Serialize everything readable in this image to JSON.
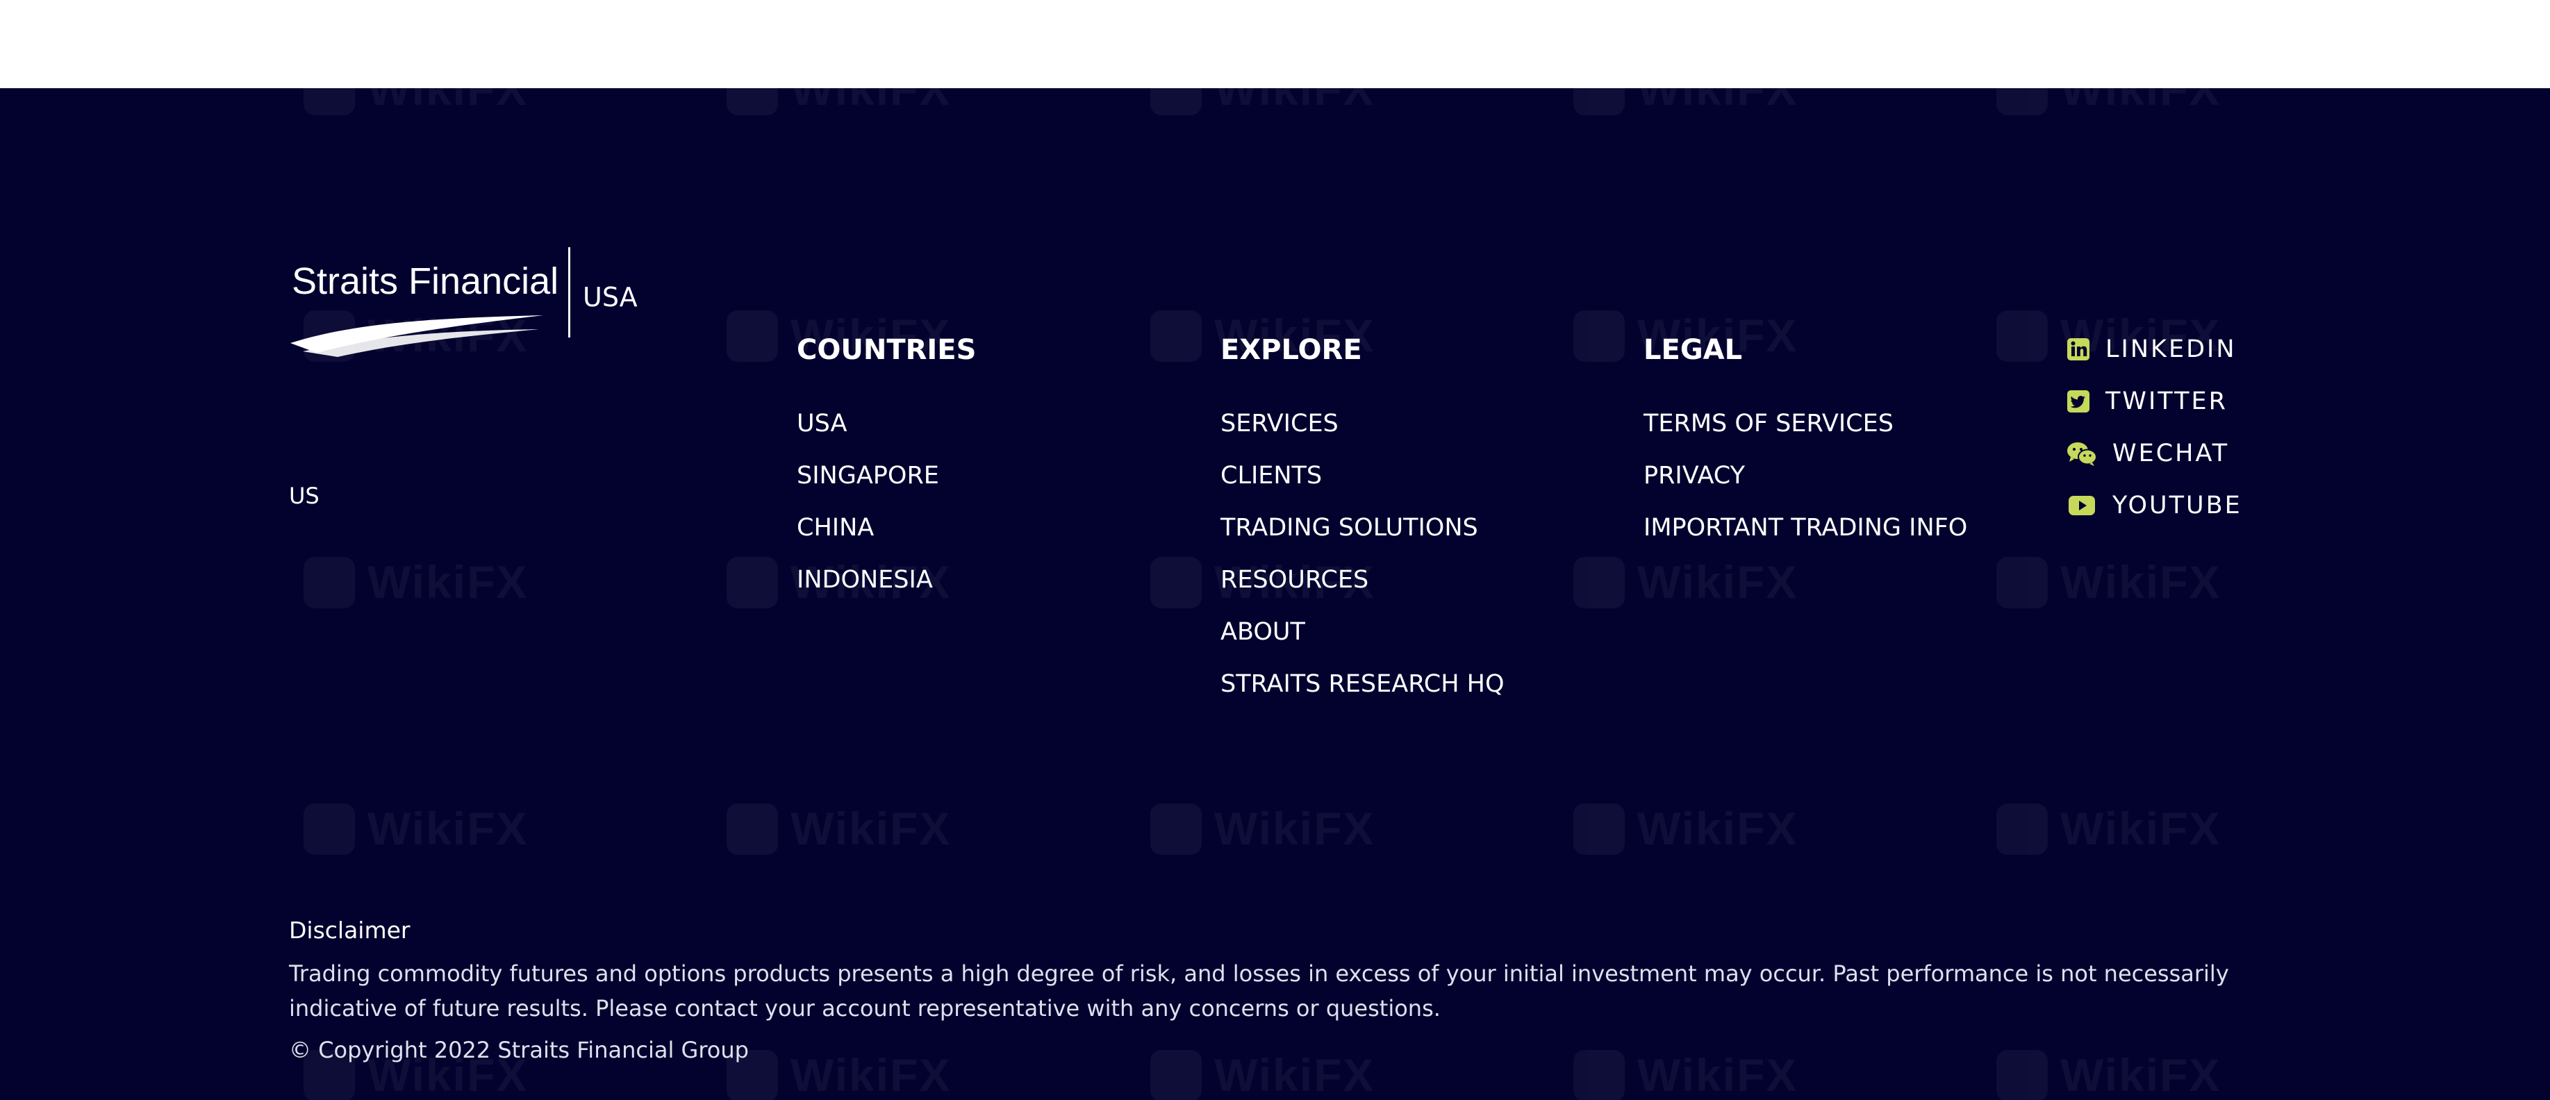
{
  "brand": {
    "name": "Straits Financial",
    "region": "USA",
    "subtitle": "US"
  },
  "columns": [
    {
      "title": "COUNTRIES",
      "items": [
        "USA",
        "SINGAPORE",
        "CHINA",
        "INDONESIA"
      ]
    },
    {
      "title": "EXPLORE",
      "items": [
        "SERVICES",
        "CLIENTS",
        "TRADING SOLUTIONS",
        "RESOURCES",
        "ABOUT",
        "STRAITS RESEARCH HQ"
      ]
    },
    {
      "title": "LEGAL",
      "items": [
        "TERMS OF SERVICES",
        "PRIVACY",
        "IMPORTANT TRADING INFO"
      ]
    }
  ],
  "social": [
    {
      "label": "LINKEDIN",
      "icon": "linkedin-icon"
    },
    {
      "label": "TWITTER",
      "icon": "twitter-icon"
    },
    {
      "label": "WECHAT",
      "icon": "wechat-icon"
    },
    {
      "label": "YOUTUBE",
      "icon": "youtube-icon"
    }
  ],
  "disclaimer": {
    "title": "Disclaimer",
    "text": "Trading commodity futures and options products presents a high degree of risk, and losses in excess of your initial investment may occur.  Past performance is not necessarily indicative of future results. Please contact your account representative with any concerns or questions.",
    "copyright": "© Copyright 2022 Straits Financial Group"
  },
  "watermark": "WikiFX",
  "colors": {
    "footer_bg": "#03022e",
    "social_accent": "#c6d95a",
    "text": "#ffffff"
  }
}
